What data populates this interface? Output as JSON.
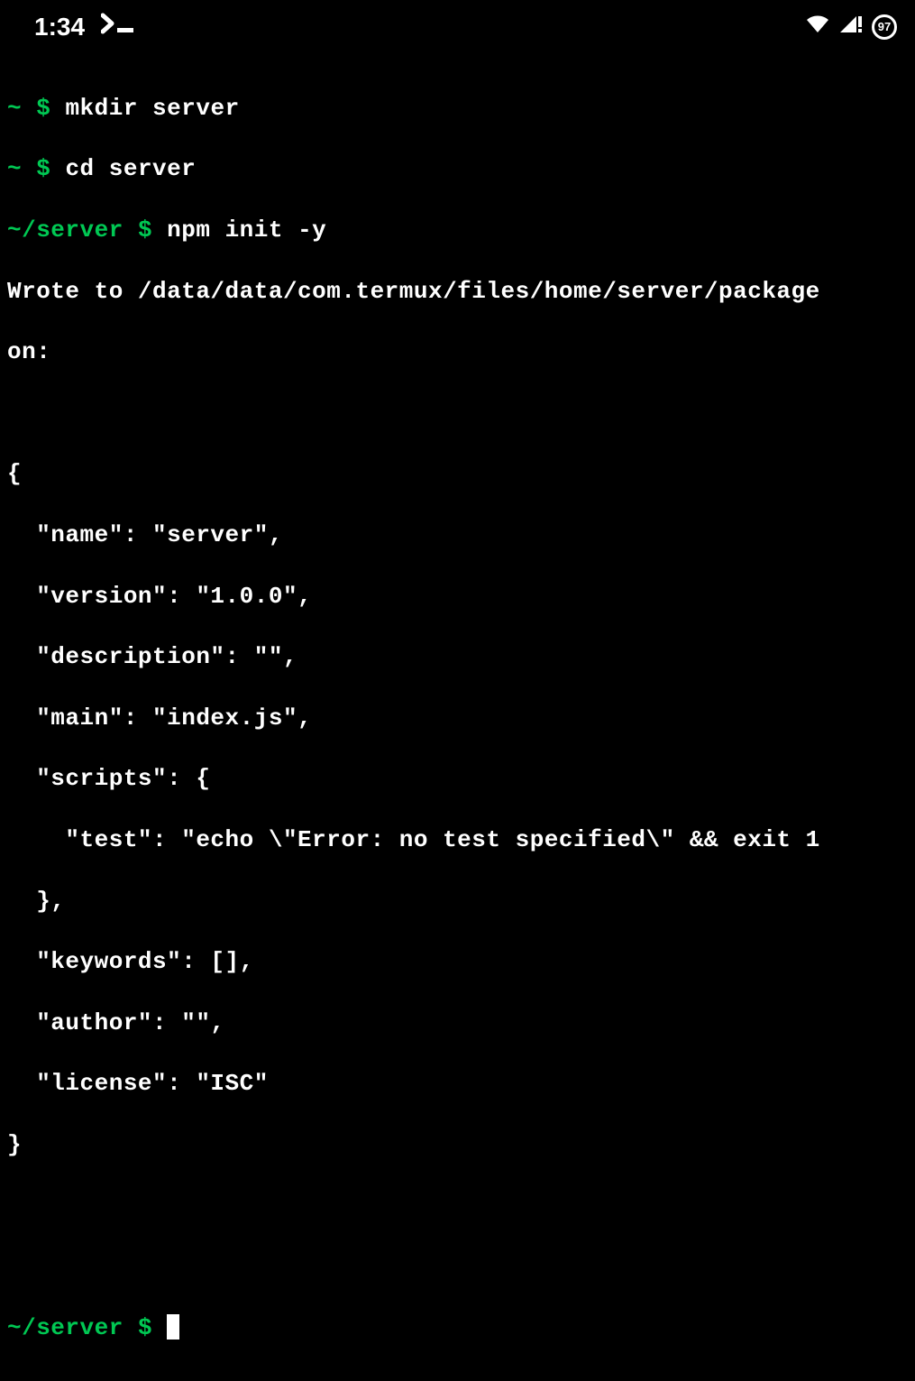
{
  "status": {
    "time": "1:34",
    "battery_level": "97"
  },
  "terminal": {
    "lines": [
      {
        "prompt": "~",
        "dollar": "$",
        "cmd": "mkdir server"
      },
      {
        "prompt": "~",
        "dollar": "$",
        "cmd": "cd server"
      },
      {
        "prompt": "~/server",
        "dollar": "$",
        "cmd": "npm init -y"
      }
    ],
    "output_1": "Wrote to /data/data/com.termux/files/home/server/package",
    "output_2": "on:",
    "json_open": "{",
    "json_name": "  \"name\": \"server\",",
    "json_version": "  \"version\": \"1.0.0\",",
    "json_description": "  \"description\": \"\",",
    "json_main": "  \"main\": \"index.js\",",
    "json_scripts_open": "  \"scripts\": {",
    "json_scripts_test": "    \"test\": \"echo \\\"Error: no test specified\\\" && exit 1",
    "json_scripts_close": "  },",
    "json_keywords": "  \"keywords\": [],",
    "json_author": "  \"author\": \"\",",
    "json_license": "  \"license\": \"ISC\"",
    "json_close": "}",
    "final_prompt": "~/server",
    "final_dollar": "$"
  }
}
